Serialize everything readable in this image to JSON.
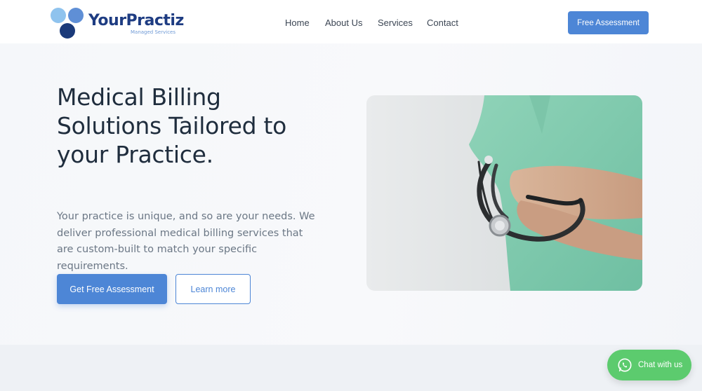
{
  "brand": {
    "name": "YourPractiz",
    "tagline": "Managed Services",
    "colors": {
      "dot_light": "#8fc3ee",
      "dot_mid": "#5f8fd6",
      "dot_dark": "#1b3a7a",
      "accent": "#4d86d6",
      "whatsapp": "#5ccb6e"
    }
  },
  "nav": {
    "items": [
      {
        "label": "Home"
      },
      {
        "label": "About Us"
      },
      {
        "label": "Services"
      },
      {
        "label": "Contact"
      }
    ],
    "cta_label": "Free Assessment"
  },
  "hero": {
    "title": "Medical Billing Solutions Tailored to your Practice.",
    "subtitle": "Your practice is unique, and so are your needs. We deliver professional medical billing services that are custom-built to match your specific requirements.",
    "primary_button": "Get Free Assessment",
    "secondary_button": "Learn more",
    "image": "healthcare worker in green scrubs holding a stethoscope"
  },
  "chat": {
    "label": "Chat with us",
    "icon": "whatsapp-icon"
  }
}
